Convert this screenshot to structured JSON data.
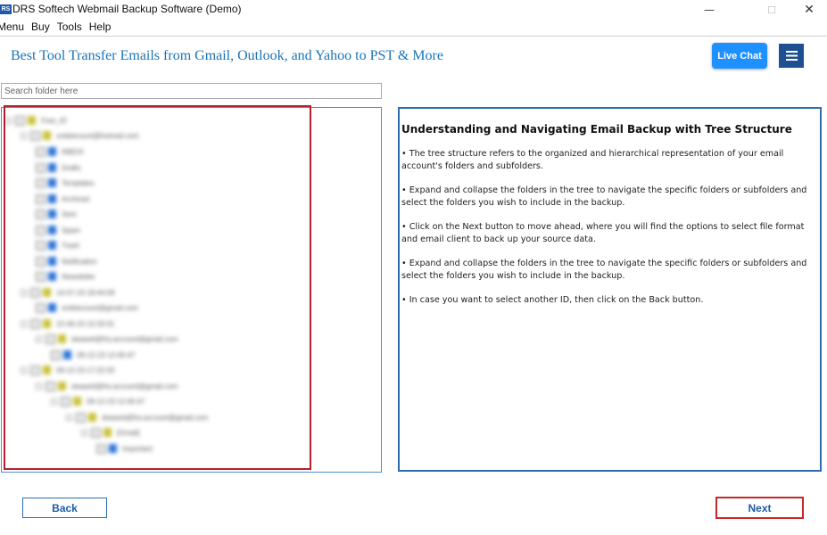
{
  "window": {
    "title": "DRS Softech Webmail Backup Software (Demo)",
    "icon_label": "RS",
    "controls": {
      "minimize": "—",
      "maximize": "☐",
      "close": "✕"
    }
  },
  "menu": [
    "Menu",
    "Buy",
    "Tools",
    "Help"
  ],
  "header": {
    "headline": "Best Tool Transfer Emails from Gmail, Outlook, and Yahoo to PST & More",
    "live_chat_label": "Live Chat"
  },
  "search": {
    "placeholder": "Search folder here"
  },
  "tree": {
    "items": [
      {
        "label": "Free_ID",
        "icon": "folder-icon"
      },
      {
        "label": "smbtecount@hotmail.com",
        "icon": "folder-icon"
      },
      {
        "label": "INBOX",
        "icon": "file-icon"
      },
      {
        "label": "Drafts",
        "icon": "file-icon"
      },
      {
        "label": "Templates",
        "icon": "file-icon"
      },
      {
        "label": "Archived",
        "icon": "file-icon"
      },
      {
        "label": "Sent",
        "icon": "file-icon"
      },
      {
        "label": "Spam",
        "icon": "file-icon"
      },
      {
        "label": "Trash",
        "icon": "file-icon"
      },
      {
        "label": "Notification",
        "icon": "file-icon"
      },
      {
        "label": "Newsletter",
        "icon": "file-icon"
      },
      {
        "label": "14-07-23 18:44:08",
        "icon": "folder-icon"
      },
      {
        "label": "smbtecount@gmail.com",
        "icon": "file-icon"
      },
      {
        "label": "22-06-23 15:33:31",
        "icon": "folder-icon"
      },
      {
        "label": "dwaseti@fra.account@gmail.com",
        "icon": "folder-icon"
      },
      {
        "label": "09-12-23 12:45:47",
        "icon": "file-icon"
      },
      {
        "label": "09-12-23 17:22:33",
        "icon": "folder-icon"
      },
      {
        "label": "dwaseti@fra.account@gmail.com",
        "icon": "folder-icon"
      },
      {
        "label": "09-12-23 12:45:47",
        "icon": "folder-icon"
      },
      {
        "label": "dwaseti@fra.account@gmail.com",
        "icon": "folder-icon"
      },
      {
        "label": "[Gmail]",
        "icon": "folder-icon"
      },
      {
        "label": "Important",
        "icon": "file-icon"
      }
    ]
  },
  "info": {
    "title": "Understanding and Navigating Email Backup with Tree Structure",
    "points": [
      "• The tree structure refers to the organized and hierarchical representation of your email account's folders and subfolders.",
      "• Expand and collapse the folders in the tree to navigate the specific folders or subfolders and select the folders you wish to include in the backup.",
      "• Click on the Next button to move ahead, where you will find the options to select file format and email client to back up your source data.",
      "• Expand and collapse the folders in the tree to navigate the specific folders or subfolders and select the folders you wish to include in the backup.",
      "• In case you want to select another ID, then click on the Back button."
    ]
  },
  "footer": {
    "back_label": "Back",
    "next_label": "Next"
  },
  "colors": {
    "headline": "#1a73b8",
    "live_chat_bg": "#1e90ff",
    "menu_button_bg": "#1d4f91",
    "panel_border": "#2a6db5",
    "highlight_border": "#b3202b"
  }
}
